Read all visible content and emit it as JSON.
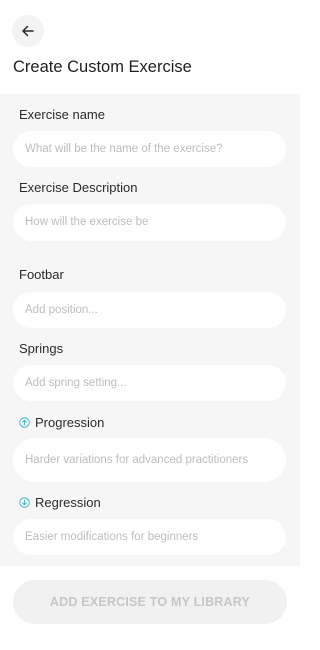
{
  "header": {
    "back_icon": "arrow-left-icon",
    "title": "Create Custom Exercise"
  },
  "form": {
    "exercise_name": {
      "label": "Exercise name",
      "placeholder": "What will be the name of the exercise?"
    },
    "exercise_description": {
      "label": "Exercise Description",
      "placeholder": "How will the exercise be"
    },
    "footbar": {
      "label": "Footbar",
      "placeholder": "Add position..."
    },
    "springs": {
      "label": "Springs",
      "placeholder": "Add spring setting..."
    },
    "progression": {
      "label": "Progression",
      "icon": "arrow-up-circle-icon",
      "placeholder": "Harder variations for advanced practitioners"
    },
    "regression": {
      "label": "Regression",
      "icon": "arrow-down-circle-icon",
      "placeholder": "Easier modifications for beginners"
    }
  },
  "actions": {
    "submit_label": "ADD EXERCISE TO MY LIBRARY"
  },
  "colors": {
    "accent": "#3fb6c2",
    "form_background": "#f6f6f6",
    "placeholder": "#bdbdbd",
    "disabled_button": "#f1f1f1",
    "disabled_text": "#c6c6c6"
  }
}
